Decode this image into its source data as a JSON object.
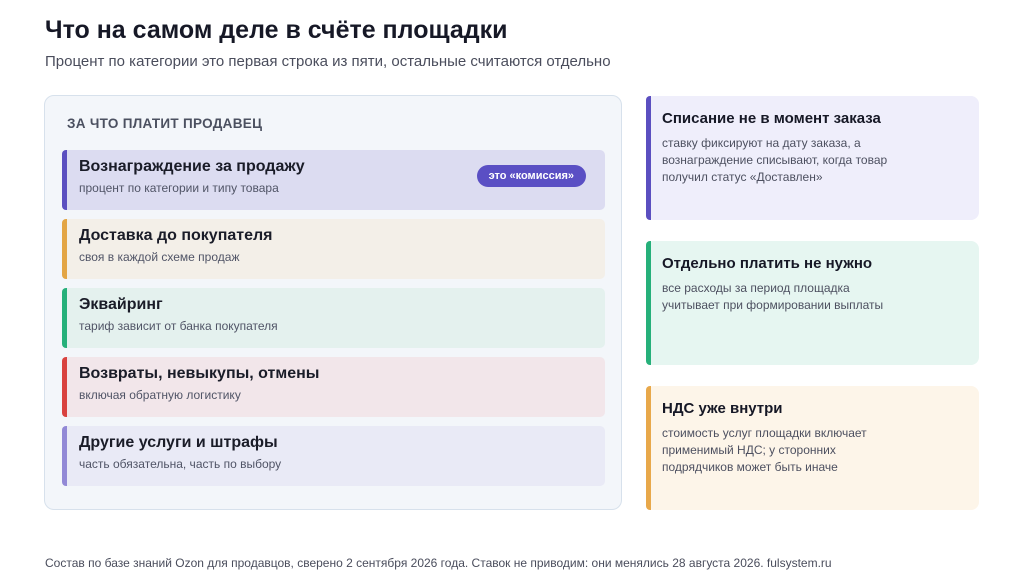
{
  "header": {
    "title": "Что на самом деле в счёте площадки",
    "subtitle": "Процент по категории это первая строка из пяти, остальные считаются отдельно"
  },
  "left_panel": {
    "heading": "ЗА ЧТО ПЛАТИТ ПРОДАВЕЦ",
    "items": [
      {
        "title": "Вознаграждение за продажу",
        "description": "процент по категории и типу товара",
        "badge": "это «комиссия»",
        "accent": "#5b4fc0",
        "background": "#dcdcf1"
      },
      {
        "title": "Доставка до покупателя",
        "description": "своя в каждой схеме продаж",
        "accent": "#e3a544",
        "background": "#f3efe8"
      },
      {
        "title": "Эквайринг",
        "description": "тариф зависит от банка покупателя",
        "accent": "#26b07a",
        "background": "#e4f1ee"
      },
      {
        "title": "Возвраты, невыкупы, отмены",
        "description": "включая обратную логистику",
        "accent": "#d9423f",
        "background": "#f2e6ea"
      },
      {
        "title": "Другие услуги и штрафы",
        "description": "часть обязательна, часть по выбору",
        "accent": "#9289d6",
        "background": "#e9eaf6"
      }
    ]
  },
  "notes": [
    {
      "title": "Списание не в момент заказа",
      "text": "ставку фиксируют на дату заказа, а вознаграждение списывают, когда товар получил статус «Доставлен»",
      "accent": "#5b4fc0",
      "background": "#efeefb"
    },
    {
      "title": "Отдельно платить не нужно",
      "text": "все расходы за период площадка учитывает при формировании выплаты",
      "accent": "#26b07a",
      "background": "#e6f6f1"
    },
    {
      "title": "НДС уже внутри",
      "text": "стоимость услуг площадки включает применимый НДС; у сторонних подрядчиков может быть иначе",
      "accent": "#e8a84a",
      "background": "#fdf5e9"
    }
  ],
  "footer": {
    "text": "Состав по базе знаний Ozon для продавцов, сверено 2 сентября 2026 года. Ставок не приводим: они менялись 28 августа 2026. fulsystem.ru"
  }
}
